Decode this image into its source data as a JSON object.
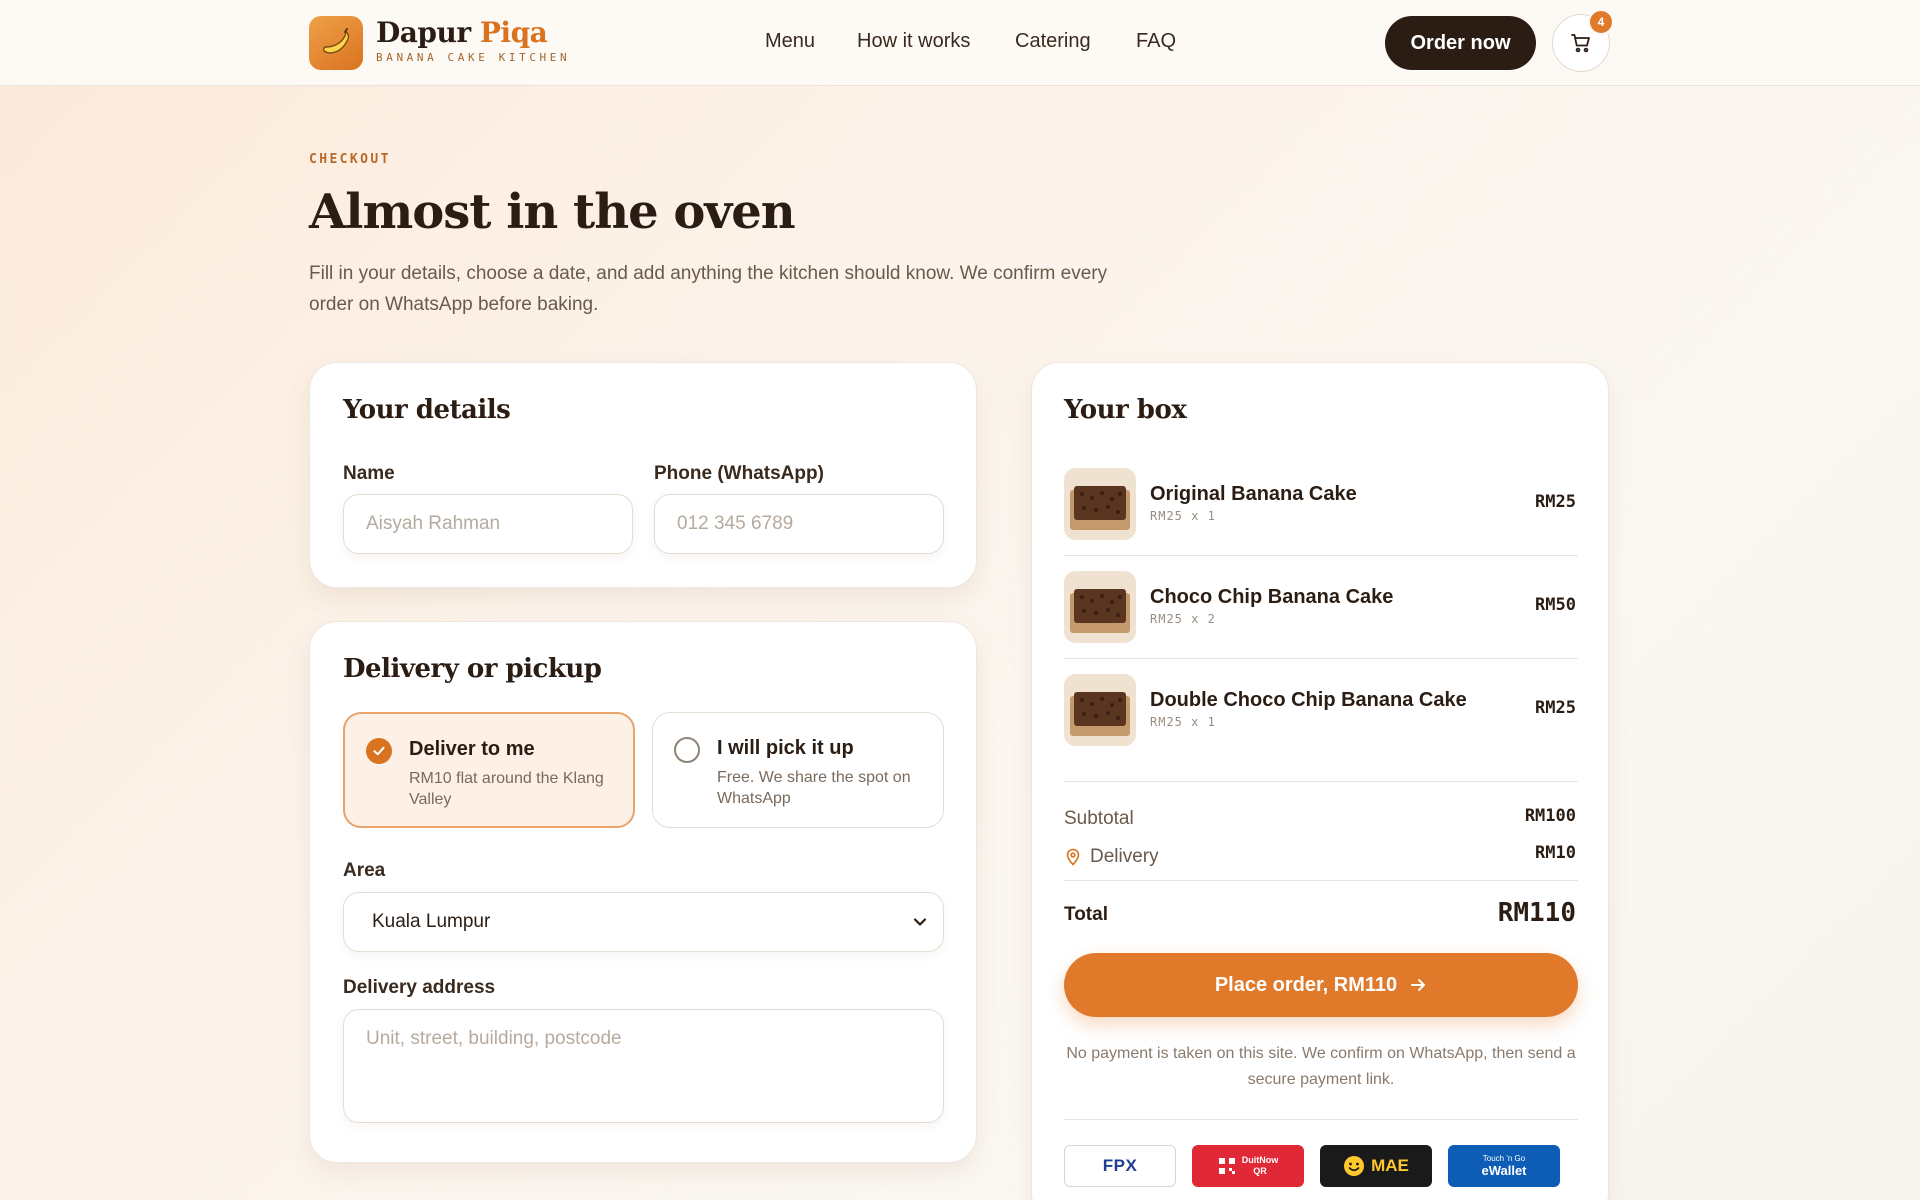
{
  "header": {
    "brand_first": "Dapur",
    "brand_second": "Piqa",
    "tagline": "BANANA CAKE KITCHEN",
    "nav": [
      {
        "label": "Menu"
      },
      {
        "label": "How it works"
      },
      {
        "label": "Catering"
      },
      {
        "label": "FAQ"
      }
    ],
    "order_button": "Order now",
    "cart_count": "4"
  },
  "hero": {
    "eyebrow": "CHECKOUT",
    "title": "Almost in the oven",
    "subtitle": "Fill in your details, choose a date, and add anything the kitchen should know. We confirm every order on WhatsApp before baking."
  },
  "details": {
    "title": "Your details",
    "name_label": "Name",
    "name_placeholder": "Aisyah Rahman",
    "phone_label": "Phone (WhatsApp)",
    "phone_placeholder": "012 345 6789"
  },
  "delivery": {
    "title": "Delivery or pickup",
    "options": [
      {
        "title": "Deliver to me",
        "desc": "RM10 flat around the Klang Valley",
        "selected": true
      },
      {
        "title": "I will pick it up",
        "desc": "Free. We share the spot on WhatsApp",
        "selected": false
      }
    ],
    "area_label": "Area",
    "area_value": "Kuala Lumpur",
    "address_label": "Delivery address",
    "address_placeholder": "Unit, street, building, postcode"
  },
  "box": {
    "title": "Your box",
    "items": [
      {
        "name": "Original Banana Cake",
        "qty": "RM25 x 1",
        "price": "RM25"
      },
      {
        "name": "Choco Chip Banana Cake",
        "qty": "RM25 x 2",
        "price": "RM50"
      },
      {
        "name": "Double Choco Chip Banana Cake",
        "qty": "RM25 x 1",
        "price": "RM25"
      }
    ],
    "subtotal_label": "Subtotal",
    "subtotal_value": "RM100",
    "delivery_label": "Delivery",
    "delivery_value": "RM10",
    "total_label": "Total",
    "total_value": "RM110",
    "place_order": "Place order, RM110",
    "note": "No payment is taken on this site. We confirm on WhatsApp, then send a secure payment link.",
    "payments": [
      {
        "label": "FPX"
      },
      {
        "label": "DuitNow QR",
        "line1": "DuitNow",
        "line2": "QR"
      },
      {
        "label": "MAE"
      },
      {
        "label": "Touch 'n Go eWallet",
        "line1": "Touch 'n Go",
        "line2": "eWallet"
      }
    ]
  },
  "colors": {
    "accent": "#e07a2a",
    "dark": "#2b1d14",
    "selected_bg": "#fdf1e7"
  }
}
